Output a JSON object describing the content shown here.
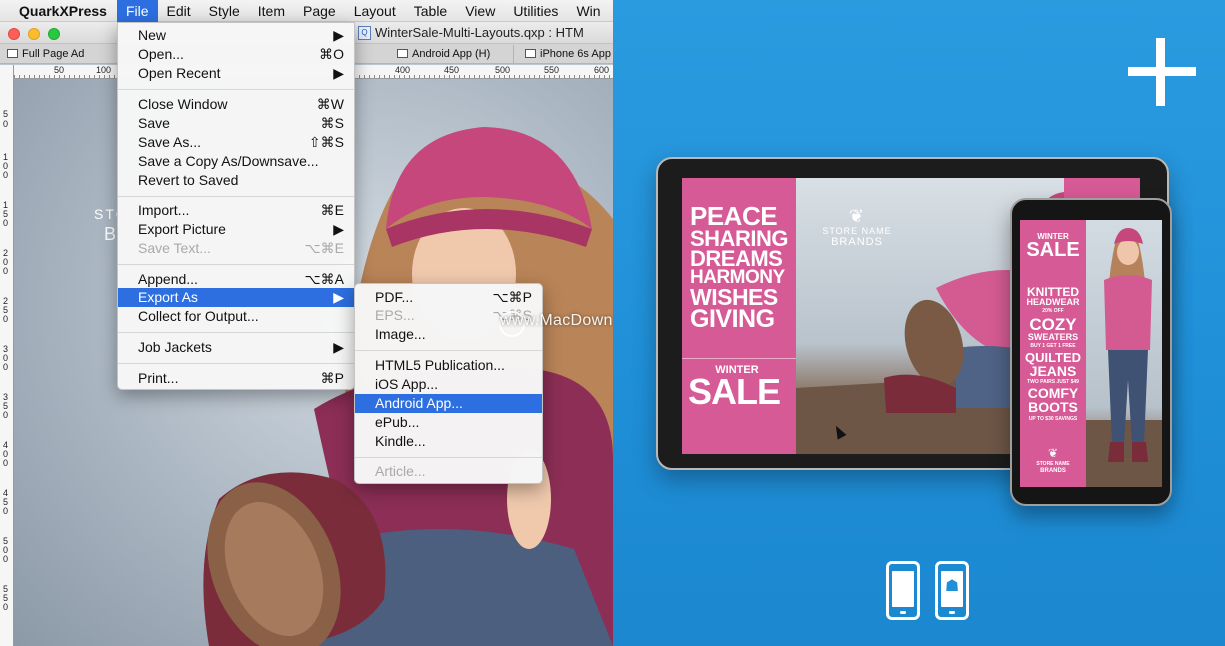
{
  "app": {
    "menubar": [
      "QuarkXPress",
      "File",
      "Edit",
      "Style",
      "Item",
      "Page",
      "Layout",
      "Table",
      "View",
      "Utilities",
      "Win"
    ],
    "document_title": "WinterSale-Multi-Layouts.qxp : HTM",
    "tabs": [
      "Full Page Ad",
      "Android App (H)",
      "iPhone 6s App"
    ],
    "ruler_h": [
      "50",
      "100",
      "400",
      "450",
      "500",
      "550",
      "600"
    ],
    "ruler_v": [
      "5",
      "0",
      "1",
      "0",
      "0",
      "1",
      "5",
      "0",
      "2",
      "0",
      "0",
      "2",
      "5",
      "0",
      "3",
      "0",
      "0",
      "3",
      "5",
      "0",
      "4",
      "0",
      "0",
      "4",
      "5",
      "0",
      "5",
      "0",
      "0",
      "5",
      "5",
      "0"
    ],
    "canvas_text": [
      "STO",
      "B"
    ]
  },
  "file_menu": {
    "items": [
      {
        "label": "New",
        "shortcut": "▶"
      },
      {
        "label": "Open...",
        "shortcut": "⌘O"
      },
      {
        "label": "Open Recent",
        "shortcut": "▶"
      },
      {
        "label": "Close Window",
        "shortcut": "⌘W"
      },
      {
        "label": "Save",
        "shortcut": "⌘S"
      },
      {
        "label": "Save As...",
        "shortcut": "⇧⌘S"
      },
      {
        "label": "Save a Copy As/Downsave...",
        "shortcut": ""
      },
      {
        "label": "Revert to Saved",
        "shortcut": ""
      },
      {
        "label": "Import...",
        "shortcut": "⌘E"
      },
      {
        "label": "Export Picture",
        "shortcut": "▶"
      },
      {
        "label": "Save Text...",
        "shortcut": "⌥⌘E"
      },
      {
        "label": "Append...",
        "shortcut": "⌥⌘A"
      },
      {
        "label": "Export As",
        "shortcut": "▶"
      },
      {
        "label": "Collect for Output...",
        "shortcut": ""
      },
      {
        "label": "Job Jackets",
        "shortcut": "▶"
      },
      {
        "label": "Print...",
        "shortcut": "⌘P"
      }
    ]
  },
  "export_menu": {
    "items": [
      {
        "label": "PDF...",
        "shortcut": "⌥⌘P"
      },
      {
        "label": "EPS...",
        "shortcut": "⌥⌘S"
      },
      {
        "label": "Image...",
        "shortcut": ""
      },
      {
        "label": "HTML5 Publication...",
        "shortcut": ""
      },
      {
        "label": "iOS App...",
        "shortcut": ""
      },
      {
        "label": "Android App...",
        "shortcut": ""
      },
      {
        "label": "ePub...",
        "shortcut": ""
      },
      {
        "label": "Kindle...",
        "shortcut": ""
      },
      {
        "label": "Article...",
        "shortcut": ""
      }
    ]
  },
  "watermark": "www.MacDown.com",
  "promo": {
    "tablet": {
      "headline": [
        "PEACE",
        "SHARING",
        "DREAMS",
        "HARMONY",
        "WISHES",
        "GIVING"
      ],
      "winter": "WINTER",
      "sale": "SALE",
      "brand": [
        "STORE NAME",
        "BRANDS"
      ]
    },
    "phone": {
      "winter": "WINTER",
      "sale": "SALE",
      "lines": [
        "KNITTED",
        "HEADWEAR",
        "20% OFF",
        "COZY",
        "SWEATERS",
        "BUY 1 GET 1 FREE",
        "QUILTED",
        "JEANS",
        "TWO PAIRS JUST $49",
        "COMFY",
        "BOOTS",
        "UP TO $30 SAVINGS"
      ],
      "brand": [
        "STORE NAME",
        "BRANDS"
      ]
    }
  },
  "colors": {
    "accent_blue": "#2d6fe0",
    "promo_blue": "#1f8fd8",
    "pink": "#d65a95"
  }
}
